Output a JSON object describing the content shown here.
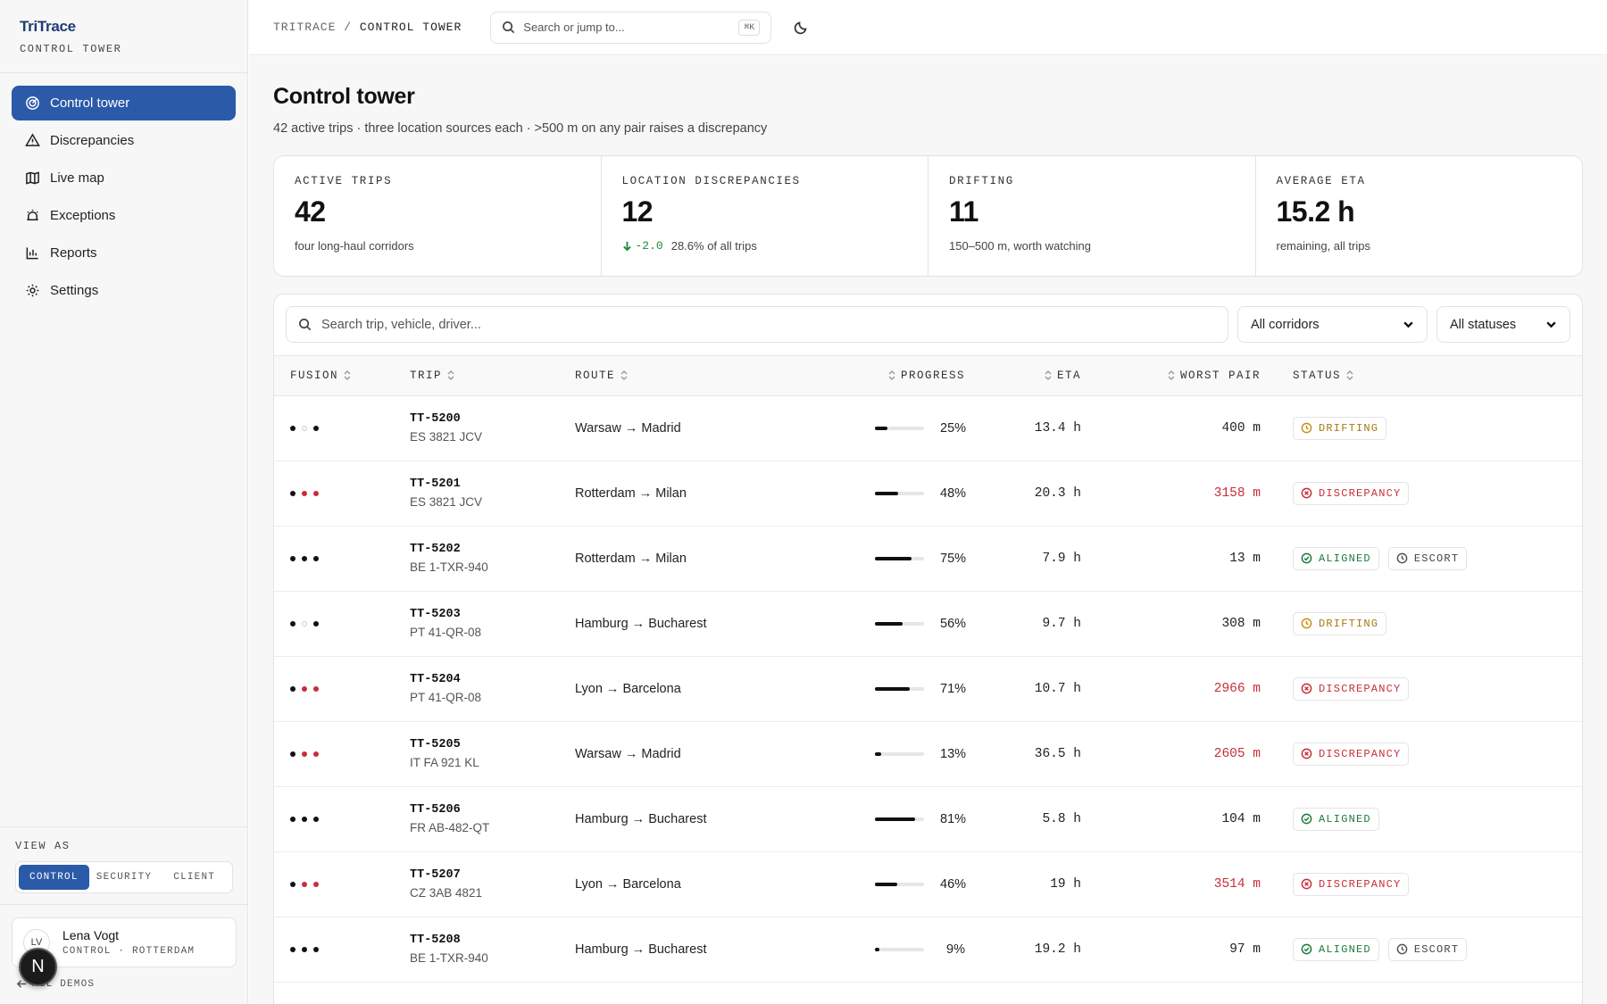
{
  "app": {
    "name": "TriTrace",
    "section": "CONTROL TOWER"
  },
  "nav": [
    {
      "label": "Control tower",
      "icon": "radar-icon",
      "active": true
    },
    {
      "label": "Discrepancies",
      "icon": "warning-icon",
      "active": false
    },
    {
      "label": "Live map",
      "icon": "map-icon",
      "active": false
    },
    {
      "label": "Exceptions",
      "icon": "siren-icon",
      "active": false
    },
    {
      "label": "Reports",
      "icon": "bar-chart-icon",
      "active": false
    },
    {
      "label": "Settings",
      "icon": "gear-icon",
      "active": false
    }
  ],
  "view_as": {
    "label": "VIEW AS",
    "options": [
      "CONTROL",
      "SECURITY",
      "CLIENT"
    ],
    "selected": "CONTROL"
  },
  "user": {
    "initials": "LV",
    "name": "Lena Vogt",
    "role": "CONTROL · ROTTERDAM"
  },
  "all_demos": "ALL DEMOS",
  "fab_label": "N",
  "topbar": {
    "breadcrumb_root": "TRITRACE",
    "breadcrumb_sep": "/",
    "breadcrumb_current": "CONTROL TOWER",
    "search_placeholder": "Search or jump to...",
    "search_shortcut": "⌘K"
  },
  "page": {
    "title": "Control tower",
    "subtitle": "42 active trips · three location sources each · >500 m on any pair raises a discrepancy"
  },
  "stats": [
    {
      "label": "ACTIVE TRIPS",
      "value": "42",
      "note": "four long-haul corridors"
    },
    {
      "label": "LOCATION DISCREPANCIES",
      "value": "12",
      "delta": "-2.0",
      "note": "28.6% of all trips"
    },
    {
      "label": "DRIFTING",
      "value": "11",
      "note": "150–500 m, worth watching"
    },
    {
      "label": "AVERAGE ETA",
      "value": "15.2 h",
      "note": "remaining, all trips"
    }
  ],
  "filters": {
    "search_placeholder": "Search trip, vehicle, driver...",
    "corridor": "All corridors",
    "status": "All statuses"
  },
  "columns": [
    "FUSION",
    "TRIP",
    "ROUTE",
    "PROGRESS",
    "ETA",
    "WORST PAIR",
    "STATUS"
  ],
  "rows": [
    {
      "fusion": [
        "black",
        "hollow",
        "black"
      ],
      "trip": "TT-5200",
      "vehicle": "ES 3821 JCV",
      "route": "Warsaw → Madrid",
      "progress": 25,
      "progress_label": "25%",
      "eta": "13.4 h",
      "worst": "400 m",
      "worst_alert": false,
      "status": "DRIFTING",
      "status_kind": "drifting",
      "escort": null
    },
    {
      "fusion": [
        "black",
        "red",
        "red"
      ],
      "trip": "TT-5201",
      "vehicle": "ES 3821 JCV",
      "route": "Rotterdam → Milan",
      "progress": 48,
      "progress_label": "48%",
      "eta": "20.3 h",
      "worst": "3158 m",
      "worst_alert": true,
      "status": "DISCREPANCY",
      "status_kind": "discrepancy",
      "escort": null
    },
    {
      "fusion": [
        "black",
        "black",
        "black"
      ],
      "trip": "TT-5202",
      "vehicle": "BE 1-TXR-940",
      "route": "Rotterdam → Milan",
      "progress": 75,
      "progress_label": "75%",
      "eta": "7.9 h",
      "worst": "13 m",
      "worst_alert": false,
      "status": "ALIGNED",
      "status_kind": "aligned",
      "escort": "ESCORT"
    },
    {
      "fusion": [
        "black",
        "hollow",
        "black"
      ],
      "trip": "TT-5203",
      "vehicle": "PT 41-QR-08",
      "route": "Hamburg → Bucharest",
      "progress": 56,
      "progress_label": "56%",
      "eta": "9.7 h",
      "worst": "308 m",
      "worst_alert": false,
      "status": "DRIFTING",
      "status_kind": "drifting",
      "escort": null
    },
    {
      "fusion": [
        "black",
        "red",
        "red"
      ],
      "trip": "TT-5204",
      "vehicle": "PT 41-QR-08",
      "route": "Lyon → Barcelona",
      "progress": 71,
      "progress_label": "71%",
      "eta": "10.7 h",
      "worst": "2966 m",
      "worst_alert": true,
      "status": "DISCREPANCY",
      "status_kind": "discrepancy",
      "escort": null
    },
    {
      "fusion": [
        "black",
        "red",
        "red"
      ],
      "trip": "TT-5205",
      "vehicle": "IT FA 921 KL",
      "route": "Warsaw → Madrid",
      "progress": 13,
      "progress_label": "13%",
      "eta": "36.5 h",
      "worst": "2605 m",
      "worst_alert": true,
      "status": "DISCREPANCY",
      "status_kind": "discrepancy",
      "escort": null
    },
    {
      "fusion": [
        "black",
        "black",
        "black"
      ],
      "trip": "TT-5206",
      "vehicle": "FR AB-482-QT",
      "route": "Hamburg → Bucharest",
      "progress": 81,
      "progress_label": "81%",
      "eta": "5.8 h",
      "worst": "104 m",
      "worst_alert": false,
      "status": "ALIGNED",
      "status_kind": "aligned",
      "escort": null
    },
    {
      "fusion": [
        "black",
        "red",
        "red"
      ],
      "trip": "TT-5207",
      "vehicle": "CZ 3AB 4821",
      "route": "Lyon → Barcelona",
      "progress": 46,
      "progress_label": "46%",
      "eta": "19 h",
      "worst": "3514 m",
      "worst_alert": true,
      "status": "DISCREPANCY",
      "status_kind": "discrepancy",
      "escort": null
    },
    {
      "fusion": [
        "black",
        "black",
        "black"
      ],
      "trip": "TT-5208",
      "vehicle": "BE 1-TXR-940",
      "route": "Hamburg → Bucharest",
      "progress": 9,
      "progress_label": "9%",
      "eta": "19.2 h",
      "worst": "97 m",
      "worst_alert": false,
      "status": "ALIGNED",
      "status_kind": "aligned",
      "escort": "ESCORT"
    }
  ],
  "colors": {
    "accent": "#2b5aa8",
    "alert": "#c62f3a",
    "ok": "#1e7a3a",
    "warn": "#c98f14"
  }
}
